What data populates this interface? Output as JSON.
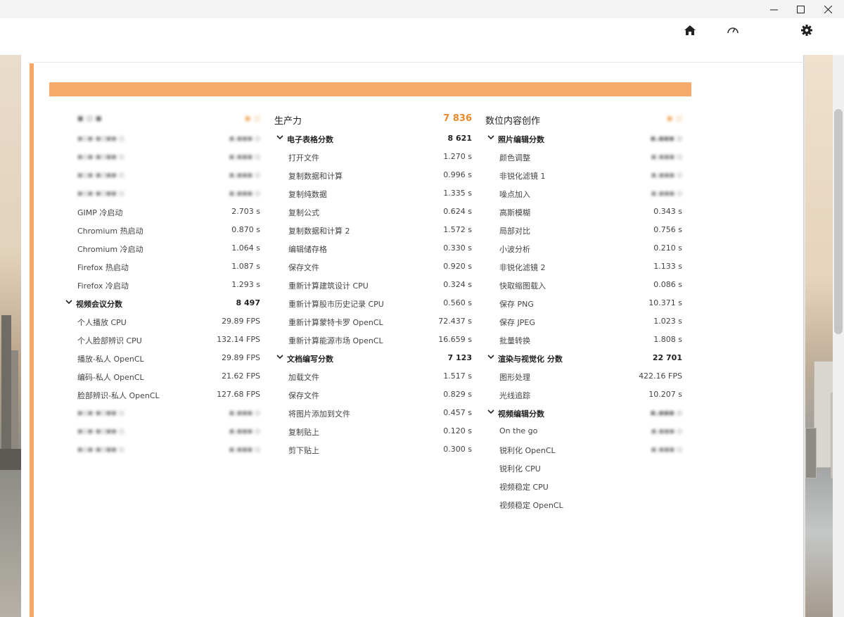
{
  "window": {
    "controls": [
      "—",
      "☐",
      "✕"
    ],
    "accent_color": "#f7a764"
  },
  "nav": {
    "icons": [
      "home-icon",
      "gauge-icon",
      "gear-icon"
    ]
  },
  "columns": [
    {
      "header": {
        "label": "",
        "score": ""
      },
      "rows": [
        {
          "type": "item",
          "label": "",
          "value": "",
          "blurred": true
        },
        {
          "type": "item",
          "label": "",
          "value": "",
          "blurred": true
        },
        {
          "type": "item",
          "label": "",
          "value": "",
          "blurred": true
        },
        {
          "type": "item",
          "label": "",
          "value": "",
          "blurred": true
        },
        {
          "type": "item",
          "label": "GIMP 冷启动",
          "value": "2.703 s"
        },
        {
          "type": "item",
          "label": "Chromium 热启动",
          "value": "0.870 s"
        },
        {
          "type": "item",
          "label": "Chromium 冷启动",
          "value": "1.064 s"
        },
        {
          "type": "item",
          "label": "Firefox 热启动",
          "value": "1.087 s"
        },
        {
          "type": "item",
          "label": "Firefox 冷启动",
          "value": "1.293 s"
        },
        {
          "type": "section",
          "label": "视频会议分数",
          "value": "8 497"
        },
        {
          "type": "item",
          "label": "个人播放 CPU",
          "value": "29.89 FPS"
        },
        {
          "type": "item",
          "label": "个人脸部辨识 CPU",
          "value": "132.14 FPS"
        },
        {
          "type": "item",
          "label": "播放-私人 OpenCL",
          "value": "29.89 FPS"
        },
        {
          "type": "item",
          "label": "编码-私人 OpenCL",
          "value": "21.62 FPS"
        },
        {
          "type": "item",
          "label": "脸部辨识-私人 OpenCL",
          "value": "127.68 FPS"
        },
        {
          "type": "item",
          "label": "",
          "value": "",
          "blurred": true
        },
        {
          "type": "item",
          "label": "",
          "value": "",
          "blurred": true
        },
        {
          "type": "item",
          "label": "",
          "value": "",
          "blurred": true
        }
      ]
    },
    {
      "header": {
        "label": "生产力",
        "score": "7 836"
      },
      "rows": [
        {
          "type": "section",
          "label": "电子表格分数",
          "value": "8 621"
        },
        {
          "type": "item",
          "label": "打开文件",
          "value": "1.270 s"
        },
        {
          "type": "item",
          "label": "复制数据和计算",
          "value": "0.996 s"
        },
        {
          "type": "item",
          "label": "复制纯数据",
          "value": "1.335 s"
        },
        {
          "type": "item",
          "label": "复制公式",
          "value": "0.624 s"
        },
        {
          "type": "item",
          "label": "复制数据和计算 2",
          "value": "1.572 s"
        },
        {
          "type": "item",
          "label": "编辑储存格",
          "value": "0.330 s"
        },
        {
          "type": "item",
          "label": "保存文件",
          "value": "0.920 s"
        },
        {
          "type": "item",
          "label": "重新计算建筑设计 CPU",
          "value": "0.324 s"
        },
        {
          "type": "item",
          "label": "重新计算股市历史记录 CPU",
          "value": "0.560 s"
        },
        {
          "type": "item",
          "label": "重新计算蒙特卡罗 OpenCL",
          "value": "72.437 s"
        },
        {
          "type": "item",
          "label": "重新计算能源市场 OpenCL",
          "value": "16.659 s"
        },
        {
          "type": "section",
          "label": "文档编写分数",
          "value": "7 123"
        },
        {
          "type": "item",
          "label": "加载文件",
          "value": "1.517 s"
        },
        {
          "type": "item",
          "label": "保存文件",
          "value": "0.829 s"
        },
        {
          "type": "item",
          "label": "将图片添加到文件",
          "value": "0.457 s"
        },
        {
          "type": "item",
          "label": "复制贴上",
          "value": "0.120 s"
        },
        {
          "type": "item",
          "label": "剪下贴上",
          "value": "0.300 s"
        }
      ]
    },
    {
      "header": {
        "label": "数位内容创作",
        "score": ""
      },
      "rows": [
        {
          "type": "section",
          "label": "照片编辑分数",
          "value": "",
          "blurred_value": true
        },
        {
          "type": "item",
          "label": "颜色调整",
          "value": "",
          "blurred_value": true
        },
        {
          "type": "item",
          "label": "非锐化滤镜 1",
          "value": "",
          "blurred_value": true
        },
        {
          "type": "item",
          "label": "噪点加入",
          "value": "",
          "blurred_value": true
        },
        {
          "type": "item",
          "label": "高斯模糊",
          "value": "0.343 s"
        },
        {
          "type": "item",
          "label": "局部对比",
          "value": "0.756 s"
        },
        {
          "type": "item",
          "label": "小波分析",
          "value": "0.210 s"
        },
        {
          "type": "item",
          "label": "非锐化滤镜 2",
          "value": "1.133 s"
        },
        {
          "type": "item",
          "label": "快取缩图载入",
          "value": "0.086 s"
        },
        {
          "type": "item",
          "label": "保存 PNG",
          "value": "10.371 s"
        },
        {
          "type": "item",
          "label": "保存 JPEG",
          "value": "1.023 s"
        },
        {
          "type": "item",
          "label": "批量转换",
          "value": "1.808 s"
        },
        {
          "type": "section",
          "label": "渲染与视觉化 分数",
          "value": "22 701"
        },
        {
          "type": "item",
          "label": "图形处理",
          "value": "422.16 FPS"
        },
        {
          "type": "item",
          "label": "光线追踪",
          "value": "10.207 s"
        },
        {
          "type": "section",
          "label": "视频编辑分数",
          "value": "",
          "blurred_value": true
        },
        {
          "type": "item",
          "label": "On the go",
          "value": "",
          "blurred_value": true
        },
        {
          "type": "item",
          "label": "锐利化 OpenCL",
          "value": "",
          "blurred_value": true
        },
        {
          "type": "item",
          "label": "锐利化 CPU",
          "value": ""
        },
        {
          "type": "item",
          "label": "视频稳定 CPU",
          "value": ""
        },
        {
          "type": "item",
          "label": "视频稳定 OpenCL",
          "value": ""
        }
      ]
    }
  ]
}
